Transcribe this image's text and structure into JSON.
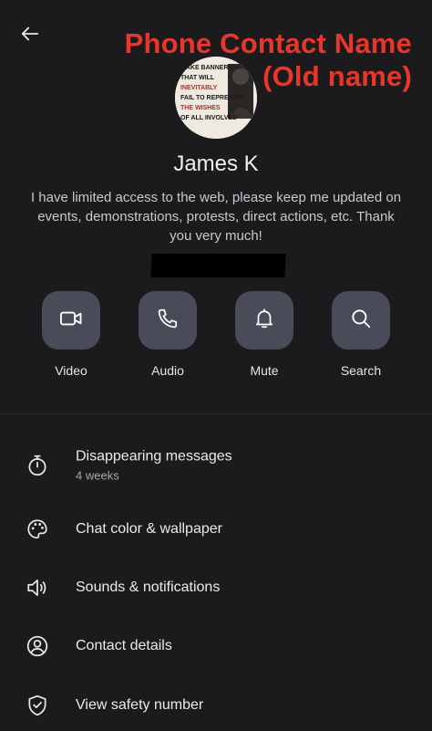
{
  "annotation": {
    "line1": "Phone Contact Name",
    "line2": "(Old name)"
  },
  "profile": {
    "name": "James K",
    "about": "I have limited access to the web, please keep me updated on events, demonstrations, protests, direct actions, etc. Thank you very much!",
    "avatar_text": [
      "MAKE BANNERS",
      "THAT WILL",
      "INEVITABLY",
      "FAIL TO REPRESENT",
      "THE WISHES",
      "OF ALL INVOLVED"
    ]
  },
  "actions": [
    {
      "label": "Video",
      "icon": "video-camera-icon"
    },
    {
      "label": "Audio",
      "icon": "phone-icon"
    },
    {
      "label": "Mute",
      "icon": "bell-icon"
    },
    {
      "label": "Search",
      "icon": "search-icon"
    }
  ],
  "settings": [
    {
      "title": "Disappearing messages",
      "subtitle": "4 weeks",
      "icon": "timer-icon"
    },
    {
      "title": "Chat color & wallpaper",
      "icon": "palette-icon"
    },
    {
      "title": "Sounds & notifications",
      "icon": "speaker-icon"
    },
    {
      "title": "Contact details",
      "icon": "person-circle-icon"
    },
    {
      "title": "View safety number",
      "icon": "shield-check-icon"
    }
  ],
  "colors": {
    "background": "#1b1b1d",
    "action_button": "#494c58",
    "annotation": "#e8362b"
  }
}
